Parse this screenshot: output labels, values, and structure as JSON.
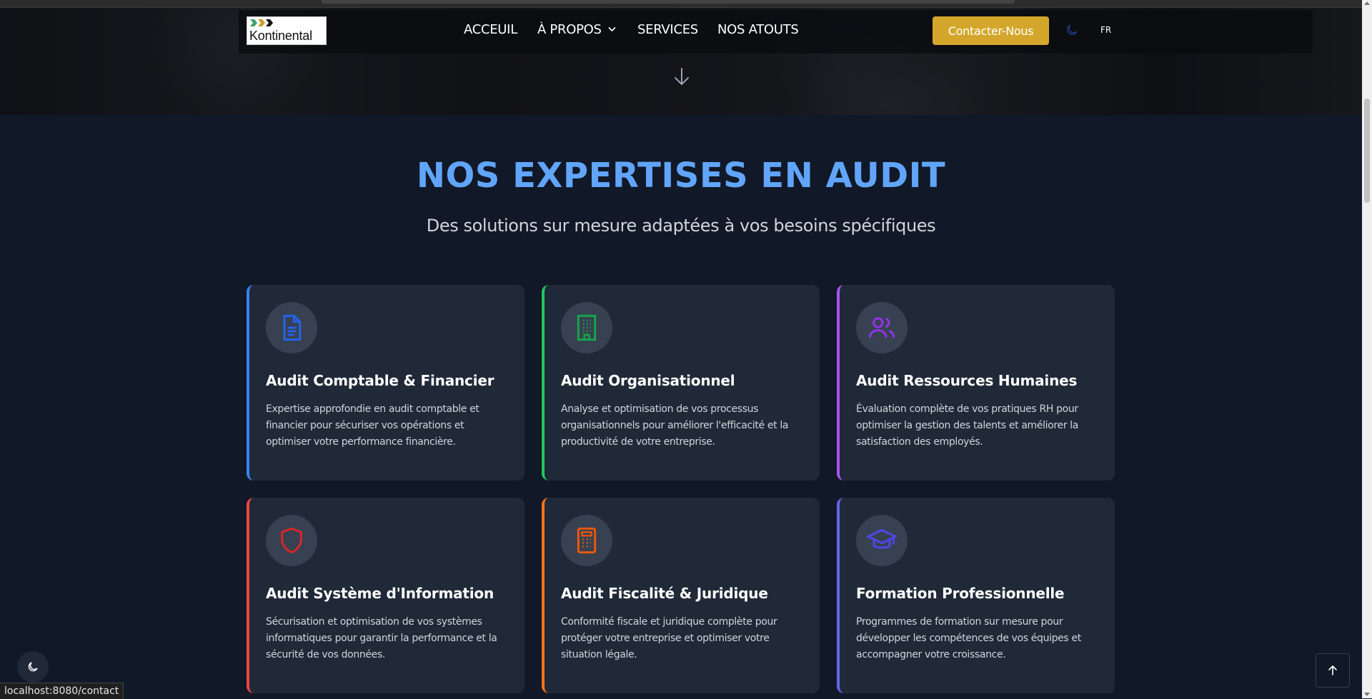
{
  "nav": {
    "logo_text": "Kontinental",
    "links": [
      "ACCEUIL",
      "À PROPOS",
      "SERVICES",
      "NOS ATOUTS"
    ],
    "cta": "Contacter-Nous",
    "lang": "FR"
  },
  "section": {
    "title": "NOS EXPERTISES EN AUDIT",
    "subtitle": "Des solutions sur mesure adaptées à vos besoins spécifiques"
  },
  "cards": [
    {
      "title": "Audit Comptable & Financier",
      "text": "Expertise approfondie en audit comptable et financier pour sécuriser vos opérations et optimiser votre performance financière.",
      "icon": "document-icon",
      "color": "#3b82f6"
    },
    {
      "title": "Audit Organisationnel",
      "text": "Analyse et optimisation de vos processus organisationnels pour améliorer l'efficacité et la productivité de votre entreprise.",
      "icon": "building-icon",
      "color": "#22c55e"
    },
    {
      "title": "Audit Ressources Humaines",
      "text": "Évaluation complète de vos pratiques RH pour optimiser la gestion des talents et améliorer la satisfaction des employés.",
      "icon": "users-icon",
      "color": "#a855f7"
    },
    {
      "title": "Audit Système d'Information",
      "text": "Sécurisation et optimisation de vos systèmes informatiques pour garantir la performance et la sécurité de vos données.",
      "icon": "shield-icon",
      "color": "#ef4444"
    },
    {
      "title": "Audit Fiscalité & Juridique",
      "text": "Conformité fiscale et juridique complète pour protéger votre entreprise et optimiser votre situation légale.",
      "icon": "calculator-icon",
      "color": "#f97316"
    },
    {
      "title": "Formation Professionnelle",
      "text": "Programmes de formation sur mesure pour développer les compétences de vos équipes et accompagner votre croissance.",
      "icon": "graduation-cap-icon",
      "color": "#6366f1"
    }
  ],
  "status_url": "localhost:8080/contact"
}
